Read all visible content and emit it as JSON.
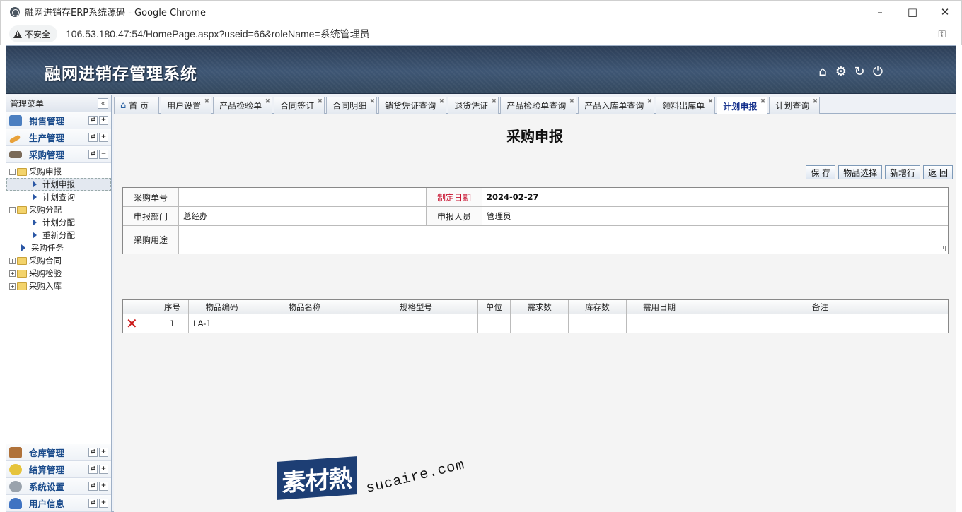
{
  "window": {
    "title": "融网进销存ERP系统源码 - Google Chrome"
  },
  "address": {
    "security_label": "不安全",
    "url": "106.53.180.47:54/HomePage.aspx?useid=66&roleName=系统管理员"
  },
  "app": {
    "title": "融网进销存管理系统"
  },
  "sidebar": {
    "header": "管理菜单",
    "top_groups": [
      {
        "label": "销售管理"
      },
      {
        "label": "生产管理"
      },
      {
        "label": "采购管理"
      }
    ],
    "tree": [
      {
        "label": "采购申报"
      },
      {
        "label": "计划申报"
      },
      {
        "label": "计划查询"
      },
      {
        "label": "采购分配"
      },
      {
        "label": "计划分配"
      },
      {
        "label": "重新分配"
      },
      {
        "label": "采购任务"
      },
      {
        "label": "采购合同"
      },
      {
        "label": "采购检验"
      },
      {
        "label": "采购入库"
      }
    ],
    "bottom_groups": [
      {
        "label": "仓库管理"
      },
      {
        "label": "结算管理"
      },
      {
        "label": "系统设置"
      },
      {
        "label": "用户信息"
      }
    ]
  },
  "tabs": [
    {
      "label": "首 页"
    },
    {
      "label": "用户设置"
    },
    {
      "label": "产品检验单"
    },
    {
      "label": "合同签订"
    },
    {
      "label": "合同明细"
    },
    {
      "label": "销货凭证查询"
    },
    {
      "label": "退货凭证"
    },
    {
      "label": "产品检验单查询"
    },
    {
      "label": "产品入库单查询"
    },
    {
      "label": "领料出库单"
    },
    {
      "label": "计划申报"
    },
    {
      "label": "计划查询"
    }
  ],
  "page": {
    "title": "采购申报",
    "toolbar": {
      "save": "保 存",
      "select_item": "物品选择",
      "new_row": "新增行",
      "back": "返 回"
    },
    "form": {
      "order_no_label": "采购单号",
      "order_no_value": "",
      "date_label": "制定日期",
      "date_value": "2024-02-27",
      "dept_label": "申报部门",
      "dept_value": "总经办",
      "person_label": "申报人员",
      "person_value": "管理员",
      "purpose_label": "采购用途",
      "purpose_value": ""
    },
    "grid": {
      "columns": [
        "",
        "序号",
        "物品编码",
        "物品名称",
        "规格型号",
        "单位",
        "需求数",
        "库存数",
        "需用日期",
        "备注"
      ],
      "rows": [
        {
          "seq": "1",
          "code": "LA-1",
          "name": "",
          "spec": "",
          "unit": "",
          "demand": "",
          "stock": "",
          "date": "",
          "remark": ""
        }
      ]
    }
  },
  "watermark": {
    "brand": "素材熱",
    "domain": "sucaire.com"
  },
  "colors": {
    "banner": "#34495f",
    "accent_red": "#c8102e",
    "link_blue": "#1b4c8c"
  }
}
